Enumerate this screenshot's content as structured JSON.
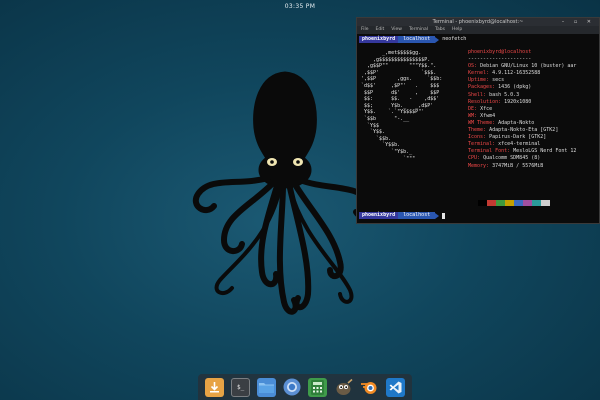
{
  "topbar": {
    "clock": "03:35 PM"
  },
  "terminal": {
    "title": "Terminal - phoenixbyrd@localhost:~",
    "window_controls": "– ▫ ✕",
    "menu": [
      "File",
      "Edit",
      "View",
      "Terminal",
      "Tabs",
      "Help"
    ],
    "prompt_user": "phoenixbyrd",
    "prompt_host": "localhost",
    "command": "neofetch",
    "logo_lines": [
      "       _,met$$$$$gg.",
      "    ,g$$$$$$$$$$$$$$$P.",
      "  ,g$$P\"\"       \"\"\"Y$$.\".",
      " ,$$P'              `$$$.",
      "',$$P       ,ggs.     `$$b:",
      "`d$$'     ,$P\"'   .    $$$",
      " $$P      d$'     ,    $$P",
      " $$:      $$.   -    ,d$$'",
      " $$;      Y$b._   _,d$P'",
      " Y$$.    `.`\"Y$$$$P\"'",
      " `$$b      \"-.__",
      "  `Y$$",
      "   `Y$$.",
      "     `$$b.",
      "       `Y$$b.",
      "          `\"Y$b._",
      "              `\"\"\""
    ],
    "info_user": "phoenixbyrd@localhost",
    "info_separator": "---------------------",
    "info": [
      {
        "key": "OS",
        "value": "Debian GNU/Linux 10 (buster) aar"
      },
      {
        "key": "Kernel",
        "value": "4.9.112-16352588"
      },
      {
        "key": "Uptime",
        "value": "secs"
      },
      {
        "key": "Packages",
        "value": "1436 (dpkg)"
      },
      {
        "key": "Shell",
        "value": "bash 5.0.3"
      },
      {
        "key": "Resolution",
        "value": "1920x1080"
      },
      {
        "key": "DE",
        "value": "Xfce"
      },
      {
        "key": "WM",
        "value": "Xfwm4"
      },
      {
        "key": "WM Theme",
        "value": "Adapta-Nokto"
      },
      {
        "key": "Theme",
        "value": "Adapta-Nokto-Eta [GTK2]"
      },
      {
        "key": "Icons",
        "value": "Papirus-Dark [GTK2]"
      },
      {
        "key": "Terminal",
        "value": "xfce4-terminal"
      },
      {
        "key": "Terminal Font",
        "value": "MesloLGS Nerd Font 12"
      },
      {
        "key": "CPU",
        "value": "Qualcomm SDM845 (8)"
      },
      {
        "key": "Memory",
        "value": "3747MiB / 5576MiB"
      }
    ],
    "palette": [
      "#000000",
      "#c23a32",
      "#3e9a3e",
      "#c4a000",
      "#3b6bc0",
      "#a04fa0",
      "#2b9b9b",
      "#d0d0d0"
    ]
  },
  "dock": {
    "items": [
      {
        "name": "downloads-icon"
      },
      {
        "name": "terminal-icon",
        "glyph": "$_"
      },
      {
        "name": "file-manager-icon"
      },
      {
        "name": "chromium-icon"
      },
      {
        "name": "calculator-icon"
      },
      {
        "name": "gimp-icon"
      },
      {
        "name": "blender-icon"
      },
      {
        "name": "vscode-icon"
      }
    ]
  }
}
